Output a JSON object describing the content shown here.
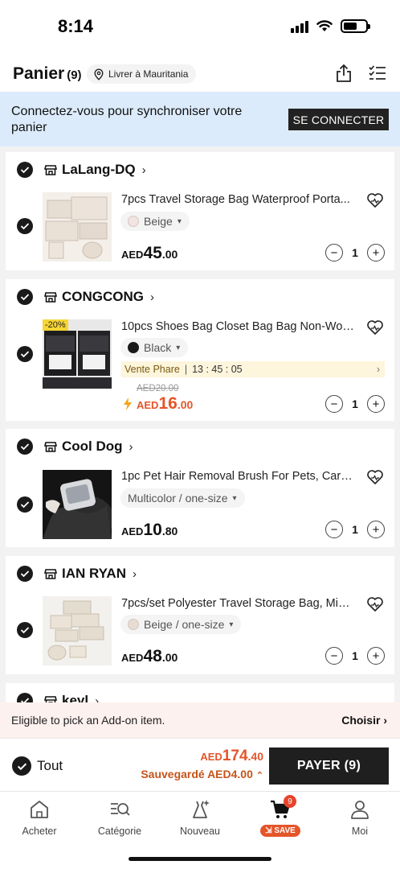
{
  "status": {
    "time": "8:14"
  },
  "header": {
    "title": "Panier",
    "count": "(9)",
    "ship_to": "Livrer à Mauritania",
    "icons": [
      "share-icon",
      "checklist-icon"
    ]
  },
  "login": {
    "text": "Connectez-vous pour synchroniser votre panier",
    "button": "SE CONNECTER"
  },
  "stores": [
    {
      "name": "LaLang-DQ",
      "item": {
        "title": "7pcs Travel Storage Bag Waterproof Porta...",
        "variant": "Beige",
        "swatch": "#f1e4e2",
        "currency": "AED",
        "price_int": "45",
        "price_dec": ".00",
        "qty": "1"
      }
    },
    {
      "name": "CONGCONG",
      "item": {
        "title": "10pcs Shoes Bag Closet Bag Bag Non-Wov...",
        "variant": "Black",
        "swatch": "#1a1a1a",
        "discount": "-20%",
        "flash_label": "Vente Phare",
        "timer": "13 : 45 : 05",
        "old_price": "AED20.00",
        "currency": "AED",
        "price_int": "16",
        "price_dec": ".00",
        "qty": "1"
      }
    },
    {
      "name": "Cool Dog",
      "item": {
        "title": "1pc  Pet Hair Removal Brush For Pets, Carp...",
        "variant": "Multicolor / one-size",
        "currency": "AED",
        "price_int": "10",
        "price_dec": ".80",
        "qty": "1"
      }
    },
    {
      "name": "IAN RYAN",
      "item": {
        "title": "7pcs/set Polyester Travel Storage Bag, Min...",
        "variant": "Beige / one-size",
        "swatch": "#e7ddd3",
        "currency": "AED",
        "price_int": "48",
        "price_dec": ".00",
        "qty": "1"
      }
    },
    {
      "name": "keyl"
    }
  ],
  "addon": {
    "text": "Eligible to pick an Add-on item.",
    "link": "Choisir"
  },
  "checkout": {
    "all_label": "Tout",
    "currency": "AED",
    "total_int": "174",
    "total_dec": ".40",
    "saved": "Sauvegardé AED4.00",
    "pay": "PAYER (9)"
  },
  "tabs": [
    {
      "label": "Acheter",
      "icon": "home-icon"
    },
    {
      "label": "Catégorie",
      "icon": "category-icon"
    },
    {
      "label": "Nouveau",
      "icon": "new-dress-icon"
    },
    {
      "label": "SAVE",
      "icon": "cart-icon",
      "badge": "9"
    },
    {
      "label": "Moi",
      "icon": "person-icon"
    }
  ]
}
